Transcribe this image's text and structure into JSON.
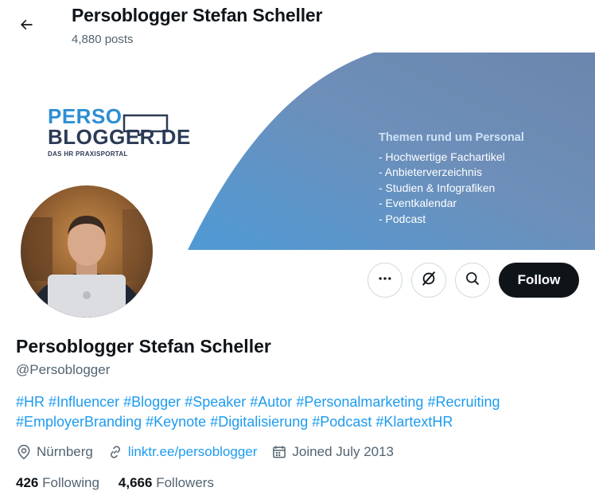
{
  "header": {
    "title": "Persoblogger Stefan Scheller",
    "post_count": "4,880 posts"
  },
  "banner": {
    "logo_line1": "PERSO",
    "logo_line2": "BLOGGER.DE",
    "logo_tagline": "DAS HR PRAXISPORTAL",
    "heading": "Themen rund um Personal",
    "items": [
      "- Hochwertige Fachartikel",
      "- Anbieterverzeichnis",
      "- Studien & Infografiken",
      "- Eventkalendar",
      "- Podcast"
    ]
  },
  "actions": {
    "more_icon": "more-icon",
    "grok_icon": "grok-icon",
    "search_icon": "search-icon",
    "follow_label": "Follow"
  },
  "profile": {
    "name": "Persoblogger Stefan Scheller",
    "handle": "@Persoblogger",
    "hashtags_line1": [
      "#HR",
      "#Influencer",
      "#Blogger",
      "#Speaker",
      "#Autor",
      "#Personalmarketing",
      "#Recruiting"
    ],
    "hashtags_line2": [
      "#EmployerBranding",
      "#Keynote",
      "#Digitalisierung",
      " #Podcast",
      "#KlartextHR"
    ],
    "location": "Nürnberg",
    "website": "linktr.ee/persoblogger",
    "joined": "Joined July 2013",
    "following_count": "426",
    "following_label": "Following",
    "followers_count": "4,666",
    "followers_label": "Followers"
  },
  "colors": {
    "accent": "#1d9bf0",
    "text": "#0f1419",
    "secondary": "#536471",
    "follow_bg": "#0f1419"
  }
}
